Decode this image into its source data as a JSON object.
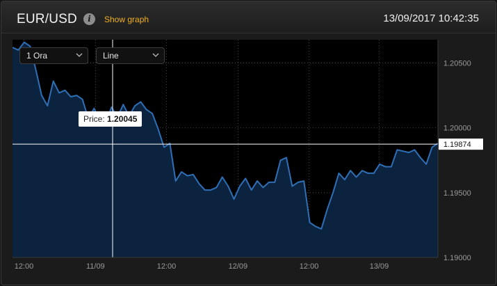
{
  "header": {
    "symbol": "EUR/USD",
    "info_icon": "i",
    "show_graph": "Show graph",
    "datetime": "13/09/2017 10:42:35"
  },
  "controls": {
    "period": "1 Ora",
    "chart_type": "Line"
  },
  "tooltip": {
    "label": "Price:",
    "value": "1.20045"
  },
  "current_price": "1.19874",
  "colors": {
    "line": "#2f6fb6",
    "fill": "#0c2340",
    "crosshair": "#ffffff",
    "price_tag_bg": "#ffffff",
    "accent": "#f0b020"
  },
  "chart_data": {
    "type": "area",
    "x_ticks": [
      "12:00",
      "11/09",
      "12:00",
      "12/09",
      "12:00",
      "13/09"
    ],
    "y_ticks": [
      "1.20500",
      "1.20000",
      "1.19500",
      "1.19000"
    ],
    "ylim": [
      1.19,
      1.2068
    ],
    "current_value": 1.19874,
    "hover_value": 1.20045,
    "grid": true,
    "values": [
      1.2062,
      1.206,
      1.2066,
      1.2063,
      1.2045,
      1.2025,
      1.2017,
      1.2036,
      1.2027,
      1.2029,
      1.2024,
      1.2025,
      1.2022,
      1.2007,
      1.2015,
      1.2004,
      1.2004,
      1.2016,
      1.2008,
      1.2018,
      1.2009,
      1.2017,
      1.202,
      1.2014,
      1.2011,
      1.1999,
      1.1985,
      1.1988,
      1.1959,
      1.1966,
      1.1963,
      1.1964,
      1.1957,
      1.1952,
      1.1952,
      1.1954,
      1.1962,
      1.1955,
      1.1945,
      1.1955,
      1.1961,
      1.1952,
      1.1959,
      1.1954,
      1.1958,
      1.1958,
      1.1975,
      1.1977,
      1.1955,
      1.1958,
      1.1959,
      1.1927,
      1.1924,
      1.1922,
      1.1937,
      1.195,
      1.1965,
      1.196,
      1.1967,
      1.1962,
      1.1967,
      1.1965,
      1.1965,
      1.1972,
      1.197,
      1.197,
      1.1983,
      1.1982,
      1.1981,
      1.1983,
      1.1977,
      1.1972,
      1.1985,
      1.1988
    ]
  }
}
